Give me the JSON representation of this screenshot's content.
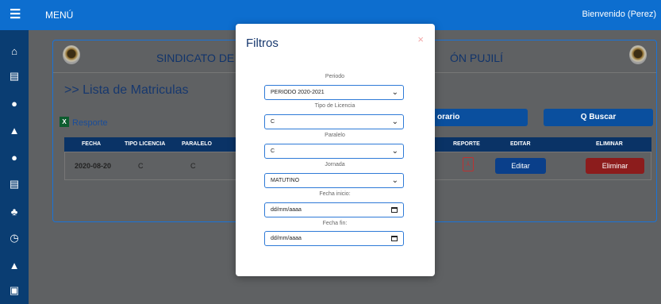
{
  "topbar": {
    "menu_label": "MENÚ",
    "welcome": "Bienvenido (Perez)"
  },
  "sidebar": {
    "items": [
      {
        "icon": "home-icon",
        "glyph": "⌂"
      },
      {
        "icon": "copy-icon",
        "glyph": "▤"
      },
      {
        "icon": "user-icon",
        "glyph": "●"
      },
      {
        "icon": "graduation-icon",
        "glyph": "▲"
      },
      {
        "icon": "user-2-icon",
        "glyph": "●"
      },
      {
        "icon": "copy-2-icon",
        "glyph": "▤"
      },
      {
        "icon": "group-icon",
        "glyph": "♣"
      },
      {
        "icon": "clock-icon",
        "glyph": "◷"
      },
      {
        "icon": "chart-icon",
        "glyph": "▲"
      },
      {
        "icon": "image-icon",
        "glyph": "▣"
      }
    ]
  },
  "main": {
    "header_left": "SINDICATO DE",
    "header_right": "ÓN PUJILÍ",
    "list_title": ">> Lista de Matriculas",
    "excel_badge": "X",
    "report_link": "Resporte",
    "horario_label": "orario",
    "buscar_label": "Q Buscar",
    "table": {
      "headers": [
        "FECHA",
        "TIPO LICENCIA",
        "PARALELO",
        "REPORTE",
        "EDITAR",
        "ELIMINAR"
      ],
      "row": {
        "fecha": "2020-08-20",
        "tipo": "C",
        "paralelo": "C",
        "pdf": "⅄",
        "edit_label": "Editar",
        "delete_label": "Eliminar"
      }
    }
  },
  "modal": {
    "title": "Filtros",
    "close": "×",
    "fields": {
      "periodo": {
        "label": "Periodo",
        "value": "PERIODO 2020-2021"
      },
      "tipo": {
        "label": "Tipo de Licencia",
        "value": "C"
      },
      "paralelo": {
        "label": "Paralelo",
        "value": "C"
      },
      "jornada": {
        "label": "Jornada",
        "value": "MATUTINO"
      },
      "fecha_inicio": {
        "label": "Fecha inicio:",
        "value": "dd/mm/aaaa"
      },
      "fecha_fin": {
        "label": "Fecha fin:",
        "value": "dd/mm/aaaa"
      }
    }
  },
  "colors": {
    "topbar": "#0d6ecf",
    "sidebar": "#0a3d72",
    "accent": "#2e7ad7",
    "danger": "#8c1c1c"
  }
}
